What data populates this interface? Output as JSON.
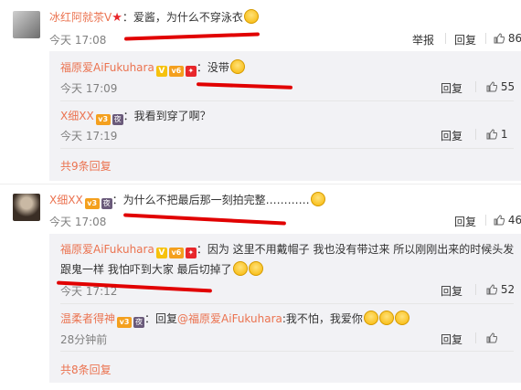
{
  "comments": [
    {
      "user": "冰红阿就茶V",
      "text": "：爱酱，为什么不穿泳衣",
      "time": "今天 17:08",
      "actions": {
        "report": "举报",
        "reply": "回复",
        "likes": "86"
      },
      "replies": [
        {
          "user": "福原爱AiFukuhara",
          "text": "：没带",
          "time": "今天 17:09",
          "reply": "回复",
          "likes": "55"
        },
        {
          "user": "X细XX",
          "text": "：我看到穿了啊？",
          "time": "今天 17:19",
          "reply": "回复",
          "likes": "1"
        }
      ],
      "more": "共9条回复"
    },
    {
      "user": "X细XX",
      "text": "：为什么不把最后那一刻拍完整…………",
      "time": "今天 17:08",
      "actions": {
        "reply": "回复",
        "likes": "46"
      },
      "replies": [
        {
          "user": "福原爱AiFukuhara",
          "text": "：因为 这里不用戴帽子 我也没有带过来 所以刚刚出来的时候头发",
          "text2": "跟鬼一样 我怕吓到大家 最后切掉了",
          "time": "今天 17:12",
          "reply": "回复",
          "likes": "52"
        },
        {
          "user": "温柔者得神",
          "text": "：回复",
          "mention": "@福原爱AiFukuhara",
          "text_after": ":我不怕，我爱你",
          "time": "28分钟前",
          "reply": "回复",
          "likes": ""
        }
      ],
      "more": "共8条回复"
    }
  ],
  "colors": {
    "accent": "#eb7350",
    "annotation": "#e10000",
    "reply_bg": "#f2f2f5"
  },
  "icons": [
    "star-icon",
    "verified-icon",
    "vip-icon",
    "thumb-up-icon",
    "emoji-icon"
  ]
}
